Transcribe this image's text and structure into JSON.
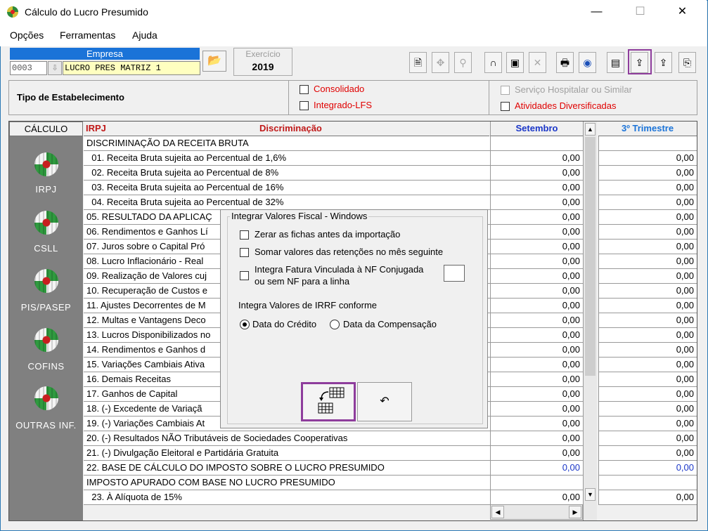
{
  "window": {
    "title": "Cálculo do Lucro Presumido",
    "controls": [
      "—",
      "☐",
      "✕"
    ]
  },
  "menu": [
    "Opções",
    "Ferramentas",
    "Ajuda"
  ],
  "empresa": {
    "label": "Empresa",
    "code": "0003",
    "name": "LUCRO  PRES MATRIZ 1"
  },
  "exercicio": {
    "label": "Exercício",
    "value": "2019"
  },
  "toolbar_icons": [
    "document-icon",
    "navigate-icon",
    "search-icon",
    "lock-icon",
    "save-icon",
    "delete-icon",
    "print-icon",
    "globe-icon",
    "report-icon",
    "import-icon",
    "export-icon",
    "exit-icon"
  ],
  "estabelecimento": {
    "label": "Tipo de Estabelecimento",
    "consolidado": "Consolidado",
    "integrado": "Integrado-LFS",
    "servico": "Serviço Hospitalar ou Similar",
    "atividades": "Atividades Diversificadas"
  },
  "sidebar": {
    "header": "CÁLCULO",
    "modules": [
      "IRPJ",
      "CSLL",
      "PIS/PASEP",
      "COFINS",
      "OUTRAS INF."
    ]
  },
  "grid": {
    "tax": "IRPJ",
    "col_disc": "Discriminação",
    "col_month": "Setembro",
    "col_quarter": "3º Trimestre",
    "rows": [
      {
        "d": "DISCRIMINAÇÃO DA RECEITA BRUTA",
        "m": "",
        "q": ""
      },
      {
        "d": "  01. Receita Bruta sujeita ao Percentual de 1,6%",
        "m": "0,00",
        "q": "0,00"
      },
      {
        "d": "  02. Receita Bruta sujeita ao Percentual de 8%",
        "m": "0,00",
        "q": "0,00"
      },
      {
        "d": "  03. Receita Bruta sujeita ao Percentual de 16%",
        "m": "0,00",
        "q": "0,00"
      },
      {
        "d": "  04. Receita Bruta sujeita ao Percentual de 32%",
        "m": "0,00",
        "q": "0,00"
      },
      {
        "d": "05. RESULTADO DA APLICAÇ",
        "m": "0,00",
        "q": "0,00"
      },
      {
        "d": "06. Rendimentos e Ganhos Lí",
        "m": "0,00",
        "q": "0,00"
      },
      {
        "d": "07. Juros sobre o Capital Pró",
        "m": "0,00",
        "q": "0,00"
      },
      {
        "d": "08. Lucro Inflacionário - Real",
        "m": "0,00",
        "q": "0,00"
      },
      {
        "d": "09. Realização de Valores cuj",
        "m": "0,00",
        "q": "0,00"
      },
      {
        "d": "10. Recuperação de Custos e",
        "m": "0,00",
        "q": "0,00"
      },
      {
        "d": "11. Ajustes Decorrentes de M",
        "m": "0,00",
        "q": "0,00"
      },
      {
        "d": "12. Multas e Vantagens Deco",
        "m": "0,00",
        "q": "0,00"
      },
      {
        "d": "13. Lucros Disponibilizados no",
        "m": "0,00",
        "q": "0,00"
      },
      {
        "d": "14. Rendimentos e Ganhos d",
        "m": "0,00",
        "q": "0,00"
      },
      {
        "d": "15. Variações Cambiais Ativa",
        "m": "0,00",
        "q": "0,00"
      },
      {
        "d": "16. Demais Receitas",
        "m": "0,00",
        "q": "0,00"
      },
      {
        "d": "17. Ganhos de Capital",
        "m": "0,00",
        "q": "0,00"
      },
      {
        "d": "18. (-) Excedente de Variaçã",
        "m": "0,00",
        "q": "0,00"
      },
      {
        "d": "19. (-) Variações Cambiais At",
        "m": "0,00",
        "q": "0,00"
      },
      {
        "d": "20. (-) Resultados NÃO Tributáveis de Sociedades Cooperativas",
        "m": "0,00",
        "q": "0,00"
      },
      {
        "d": "21. (-) Divulgação Eleitoral e Partidária Gratuita",
        "m": "0,00",
        "q": "0,00"
      },
      {
        "d": "22. BASE DE CÁLCULO DO IMPOSTO SOBRE O LUCRO PRESUMIDO",
        "m": "0,00",
        "q": "0,00",
        "blue": true
      },
      {
        "d": "IMPOSTO APURADO COM BASE NO LUCRO PRESUMIDO",
        "m": "",
        "q": ""
      },
      {
        "d": "  23. À Alíquota de 15%",
        "m": "0,00",
        "q": "0,00"
      }
    ]
  },
  "dialog": {
    "title": "Integrar Valores Fiscal - Windows",
    "opt1": "Zerar as fichas antes da importação",
    "opt2": "Somar valores das retenções no mês seguinte",
    "opt3_line1": "Integra Fatura Vinculada à NF Conjugada",
    "opt3_line2": "ou sem NF para a linha",
    "irrf_label": "Integra Valores de IRRF conforme",
    "radio1": "Data do Crédito",
    "radio2": "Data da Compensação",
    "radio_selected": "Data do Crédito"
  }
}
